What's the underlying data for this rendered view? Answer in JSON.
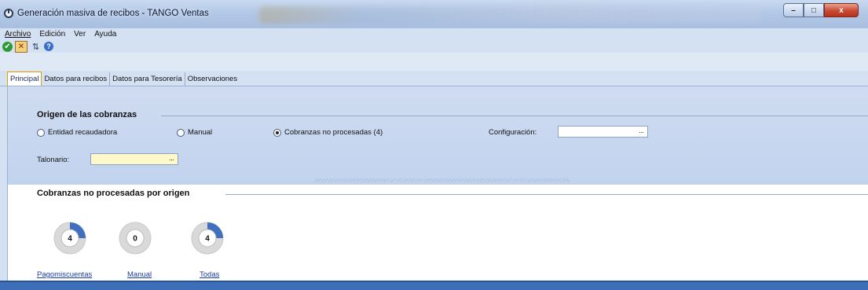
{
  "window": {
    "title": "Generación masiva de recibos - TANGO Ventas",
    "buttons": {
      "minimize": "–",
      "maximize": "□",
      "close": "x"
    }
  },
  "menu": [
    {
      "label": "Archivo"
    },
    {
      "label": "Edición"
    },
    {
      "label": "Ver"
    },
    {
      "label": "Ayuda"
    }
  ],
  "toolbar": {
    "icons": [
      "ok-check-icon",
      "cancel-icon",
      "refresh-icon",
      "help-icon"
    ]
  },
  "tabs": [
    {
      "label": "Principal",
      "active": true
    },
    {
      "label": "Datos para recibos"
    },
    {
      "label": "Datos para Tesorería"
    },
    {
      "label": "Observaciones"
    }
  ],
  "origin": {
    "title": "Origen de las cobranzas",
    "options": [
      {
        "label": "Entidad recaudadora",
        "selected": false
      },
      {
        "label": "Manual",
        "selected": false
      },
      {
        "label": "Cobranzas no procesadas (4)",
        "selected": true
      }
    ],
    "config_label": "Configuración:",
    "config_value": "",
    "talonario_label": "Talonario:",
    "talonario_value": "",
    "ellipsis": "···"
  },
  "pending": {
    "title": "Cobranzas no procesadas por origen",
    "donuts": [
      {
        "label": "Pagomiscuentas",
        "value": "4",
        "fraction": 0.25
      },
      {
        "label": "Manual",
        "value": "0",
        "fraction": 0
      },
      {
        "label": "Todas",
        "value": "4",
        "fraction": 0.25
      }
    ]
  },
  "colors": {
    "accent": "#3d6fb8",
    "donut_fill": "#3f6fbe",
    "donut_track": "#d9d9d9",
    "talonario_bg": "#fff8c8"
  }
}
